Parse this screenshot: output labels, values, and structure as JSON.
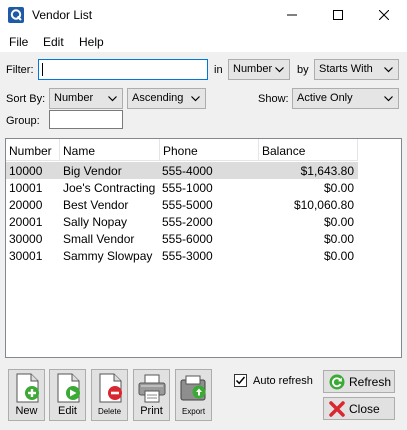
{
  "window": {
    "title": "Vendor List"
  },
  "menu": {
    "items": [
      "File",
      "Edit",
      "Help"
    ]
  },
  "filter": {
    "label": "Filter:",
    "value": "",
    "in_label": "in",
    "in_value": "Number",
    "by_label": "by",
    "by_value": "Starts With"
  },
  "sort": {
    "label": "Sort By:",
    "field": "Number",
    "order": "Ascending",
    "show_label": "Show:",
    "show_value": "Active Only"
  },
  "group": {
    "label": "Group:",
    "value": ""
  },
  "table": {
    "columns": [
      "Number",
      "Name",
      "Phone",
      "Balance"
    ],
    "rows": [
      {
        "number": "10000",
        "name": "Big Vendor",
        "phone": "555-4000",
        "balance": "$1,643.80"
      },
      {
        "number": "10001",
        "name": "Joe's Contracting",
        "phone": "555-1000",
        "balance": "$0.00"
      },
      {
        "number": "20000",
        "name": "Best Vendor",
        "phone": "555-5000",
        "balance": "$10,060.80"
      },
      {
        "number": "20001",
        "name": "Sally Nopay",
        "phone": "555-2000",
        "balance": "$0.00"
      },
      {
        "number": "30000",
        "name": "Small Vendor",
        "phone": "555-6000",
        "balance": "$0.00"
      },
      {
        "number": "30001",
        "name": "Sammy Slowpay",
        "phone": "555-3000",
        "balance": "$0.00"
      }
    ]
  },
  "toolbar": {
    "new": "New",
    "edit": "Edit",
    "delete": "Delete",
    "print": "Print",
    "export": "Export"
  },
  "auto_refresh": {
    "label": "Auto refresh",
    "checked": true
  },
  "buttons": {
    "refresh": "Refresh",
    "close": "Close"
  },
  "colors": {
    "selection": "#dcdcdc",
    "focus_border": "#0078d7",
    "delete_red": "#d9262f",
    "go_green": "#3aaa35"
  }
}
